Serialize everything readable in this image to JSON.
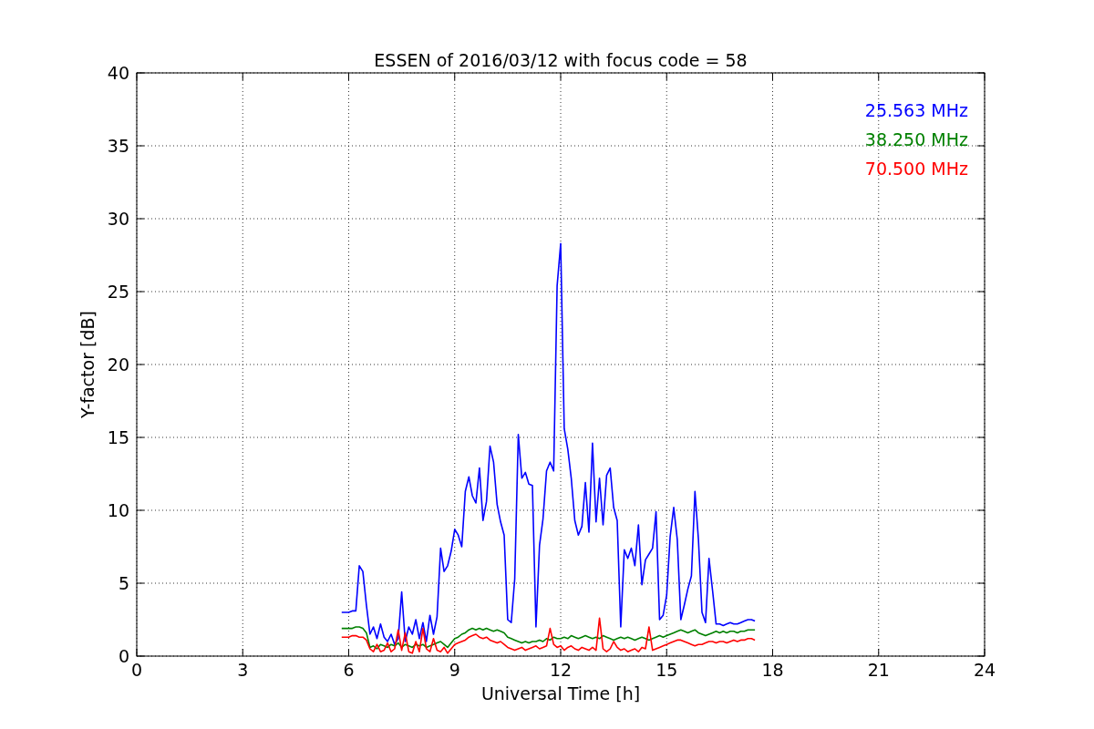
{
  "chart_data": {
    "type": "line",
    "title": "ESSEN of 2016/03/12 with focus code = 58",
    "xlabel": "Universal Time [h]",
    "ylabel": "Y-factor [dB]",
    "x": [
      5.8,
      5.9,
      6.0,
      6.1,
      6.2,
      6.3,
      6.4,
      6.5,
      6.6,
      6.7,
      6.8,
      6.9,
      7.0,
      7.1,
      7.2,
      7.3,
      7.4,
      7.5,
      7.6,
      7.7,
      7.8,
      7.9,
      8.0,
      8.1,
      8.2,
      8.3,
      8.4,
      8.5,
      8.6,
      8.7,
      8.8,
      8.9,
      9.0,
      9.1,
      9.2,
      9.3,
      9.4,
      9.5,
      9.6,
      9.7,
      9.8,
      9.9,
      10.0,
      10.1,
      10.2,
      10.3,
      10.4,
      10.5,
      10.6,
      10.7,
      10.8,
      10.9,
      11.0,
      11.1,
      11.2,
      11.3,
      11.4,
      11.5,
      11.6,
      11.7,
      11.8,
      11.9,
      12.0,
      12.1,
      12.2,
      12.3,
      12.4,
      12.5,
      12.6,
      12.7,
      12.8,
      12.9,
      13.0,
      13.1,
      13.2,
      13.3,
      13.4,
      13.5,
      13.6,
      13.7,
      13.8,
      13.9,
      14.0,
      14.1,
      14.2,
      14.3,
      14.4,
      14.5,
      14.6,
      14.7,
      14.8,
      14.9,
      15.0,
      15.1,
      15.2,
      15.3,
      15.4,
      15.5,
      15.6,
      15.7,
      15.8,
      15.9,
      16.0,
      16.1,
      16.2,
      16.3,
      16.4,
      16.5,
      16.6,
      16.7,
      16.8,
      16.9,
      17.0,
      17.1,
      17.2,
      17.3,
      17.4,
      17.5
    ],
    "series": [
      {
        "name": "25.563 MHz",
        "color": "#0000ff",
        "values": [
          3.0,
          3.0,
          3.0,
          3.1,
          3.1,
          6.2,
          5.8,
          3.5,
          1.5,
          2.0,
          1.2,
          2.2,
          1.3,
          1.0,
          1.5,
          0.8,
          1.2,
          4.4,
          1.0,
          2.0,
          1.5,
          2.5,
          1.2,
          2.3,
          1.0,
          2.8,
          1.5,
          2.7,
          7.4,
          5.8,
          6.2,
          7.2,
          8.7,
          8.3,
          7.5,
          11.3,
          12.3,
          11.0,
          10.5,
          12.9,
          9.3,
          10.6,
          14.4,
          13.3,
          10.4,
          9.2,
          8.3,
          2.5,
          2.3,
          5.3,
          15.2,
          12.2,
          12.6,
          11.8,
          11.7,
          2.0,
          7.6,
          9.4,
          12.7,
          13.3,
          12.7,
          25.4,
          28.3,
          15.6,
          14.2,
          12.2,
          9.3,
          8.3,
          8.9,
          11.9,
          8.5,
          14.6,
          9.2,
          12.2,
          9.0,
          12.4,
          12.9,
          10.2,
          9.3,
          2.0,
          7.3,
          6.7,
          7.4,
          6.2,
          9.0,
          4.9,
          6.6,
          7.0,
          7.4,
          9.9,
          2.5,
          2.8,
          4.2,
          8.2,
          10.2,
          8.0,
          2.5,
          3.5,
          4.6,
          5.5,
          11.3,
          8.0,
          3.0,
          2.3,
          6.7,
          4.5,
          2.2,
          2.2,
          2.1,
          2.2,
          2.3,
          2.2,
          2.2,
          2.3,
          2.4,
          2.5,
          2.5,
          2.4
        ]
      },
      {
        "name": "38.250 MHz",
        "color": "#008000",
        "values": [
          1.9,
          1.9,
          1.9,
          1.9,
          2.0,
          2.0,
          1.9,
          1.6,
          0.6,
          0.7,
          0.5,
          0.8,
          0.7,
          0.6,
          0.8,
          0.7,
          0.9,
          0.6,
          0.8,
          0.7,
          0.6,
          0.8,
          0.7,
          0.8,
          0.6,
          0.7,
          0.8,
          0.9,
          1.0,
          0.8,
          0.6,
          0.9,
          1.2,
          1.3,
          1.5,
          1.6,
          1.8,
          1.9,
          1.8,
          1.9,
          1.8,
          1.9,
          1.8,
          1.7,
          1.8,
          1.7,
          1.6,
          1.3,
          1.2,
          1.1,
          1.0,
          0.9,
          1.0,
          0.9,
          1.0,
          1.0,
          1.1,
          1.0,
          1.2,
          1.1,
          1.3,
          1.2,
          1.2,
          1.3,
          1.2,
          1.4,
          1.3,
          1.2,
          1.3,
          1.4,
          1.3,
          1.2,
          1.3,
          1.2,
          1.4,
          1.3,
          1.2,
          1.1,
          1.2,
          1.3,
          1.2,
          1.3,
          1.2,
          1.1,
          1.2,
          1.3,
          1.2,
          1.1,
          1.2,
          1.3,
          1.4,
          1.3,
          1.4,
          1.5,
          1.6,
          1.7,
          1.8,
          1.7,
          1.6,
          1.7,
          1.8,
          1.6,
          1.5,
          1.4,
          1.5,
          1.6,
          1.7,
          1.6,
          1.7,
          1.6,
          1.7,
          1.7,
          1.6,
          1.7,
          1.7,
          1.8,
          1.8,
          1.8
        ]
      },
      {
        "name": "70.500 MHz",
        "color": "#ff0000",
        "values": [
          1.3,
          1.3,
          1.3,
          1.4,
          1.4,
          1.3,
          1.3,
          1.1,
          0.5,
          0.3,
          0.8,
          0.3,
          0.4,
          0.9,
          0.3,
          0.5,
          1.8,
          0.4,
          1.6,
          0.3,
          0.2,
          1.0,
          0.3,
          1.9,
          0.5,
          0.3,
          1.2,
          0.4,
          0.3,
          0.6,
          0.2,
          0.5,
          0.8,
          0.9,
          1.0,
          1.1,
          1.3,
          1.4,
          1.5,
          1.3,
          1.2,
          1.3,
          1.1,
          1.0,
          0.9,
          1.0,
          0.8,
          0.6,
          0.5,
          0.4,
          0.5,
          0.6,
          0.4,
          0.5,
          0.6,
          0.7,
          0.5,
          0.6,
          0.7,
          1.9,
          0.8,
          0.6,
          0.7,
          0.4,
          0.6,
          0.7,
          0.5,
          0.4,
          0.6,
          0.5,
          0.4,
          0.6,
          0.4,
          2.6,
          0.5,
          0.3,
          0.5,
          1.0,
          0.6,
          0.4,
          0.5,
          0.3,
          0.4,
          0.5,
          0.3,
          0.6,
          0.5,
          2.0,
          0.4,
          0.5,
          0.6,
          0.7,
          0.8,
          0.9,
          1.0,
          1.1,
          1.1,
          1.0,
          0.9,
          0.8,
          0.7,
          0.8,
          0.8,
          0.9,
          1.0,
          1.0,
          0.9,
          1.0,
          1.0,
          0.9,
          1.0,
          1.1,
          1.0,
          1.1,
          1.1,
          1.2,
          1.2,
          1.1
        ]
      }
    ],
    "grid": true,
    "xlim": [
      0,
      24
    ],
    "ylim": [
      0,
      40
    ],
    "xticks": [
      0,
      3,
      6,
      9,
      12,
      15,
      18,
      21,
      24
    ],
    "yticks": [
      0,
      5,
      10,
      15,
      20,
      25,
      30,
      35,
      40
    ]
  }
}
